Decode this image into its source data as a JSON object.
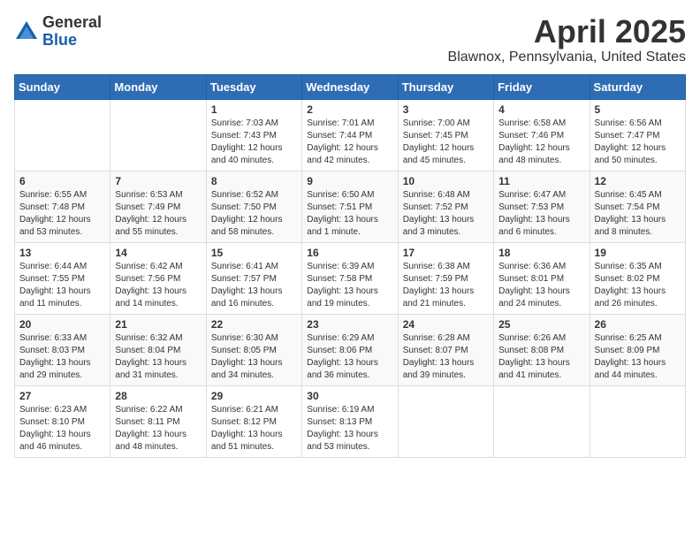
{
  "header": {
    "logo_general": "General",
    "logo_blue": "Blue",
    "month": "April 2025",
    "location": "Blawnox, Pennsylvania, United States"
  },
  "weekdays": [
    "Sunday",
    "Monday",
    "Tuesday",
    "Wednesday",
    "Thursday",
    "Friday",
    "Saturday"
  ],
  "weeks": [
    [
      null,
      null,
      {
        "day": 1,
        "sunrise": "Sunrise: 7:03 AM",
        "sunset": "Sunset: 7:43 PM",
        "daylight": "Daylight: 12 hours and 40 minutes."
      },
      {
        "day": 2,
        "sunrise": "Sunrise: 7:01 AM",
        "sunset": "Sunset: 7:44 PM",
        "daylight": "Daylight: 12 hours and 42 minutes."
      },
      {
        "day": 3,
        "sunrise": "Sunrise: 7:00 AM",
        "sunset": "Sunset: 7:45 PM",
        "daylight": "Daylight: 12 hours and 45 minutes."
      },
      {
        "day": 4,
        "sunrise": "Sunrise: 6:58 AM",
        "sunset": "Sunset: 7:46 PM",
        "daylight": "Daylight: 12 hours and 48 minutes."
      },
      {
        "day": 5,
        "sunrise": "Sunrise: 6:56 AM",
        "sunset": "Sunset: 7:47 PM",
        "daylight": "Daylight: 12 hours and 50 minutes."
      }
    ],
    [
      {
        "day": 6,
        "sunrise": "Sunrise: 6:55 AM",
        "sunset": "Sunset: 7:48 PM",
        "daylight": "Daylight: 12 hours and 53 minutes."
      },
      {
        "day": 7,
        "sunrise": "Sunrise: 6:53 AM",
        "sunset": "Sunset: 7:49 PM",
        "daylight": "Daylight: 12 hours and 55 minutes."
      },
      {
        "day": 8,
        "sunrise": "Sunrise: 6:52 AM",
        "sunset": "Sunset: 7:50 PM",
        "daylight": "Daylight: 12 hours and 58 minutes."
      },
      {
        "day": 9,
        "sunrise": "Sunrise: 6:50 AM",
        "sunset": "Sunset: 7:51 PM",
        "daylight": "Daylight: 13 hours and 1 minute."
      },
      {
        "day": 10,
        "sunrise": "Sunrise: 6:48 AM",
        "sunset": "Sunset: 7:52 PM",
        "daylight": "Daylight: 13 hours and 3 minutes."
      },
      {
        "day": 11,
        "sunrise": "Sunrise: 6:47 AM",
        "sunset": "Sunset: 7:53 PM",
        "daylight": "Daylight: 13 hours and 6 minutes."
      },
      {
        "day": 12,
        "sunrise": "Sunrise: 6:45 AM",
        "sunset": "Sunset: 7:54 PM",
        "daylight": "Daylight: 13 hours and 8 minutes."
      }
    ],
    [
      {
        "day": 13,
        "sunrise": "Sunrise: 6:44 AM",
        "sunset": "Sunset: 7:55 PM",
        "daylight": "Daylight: 13 hours and 11 minutes."
      },
      {
        "day": 14,
        "sunrise": "Sunrise: 6:42 AM",
        "sunset": "Sunset: 7:56 PM",
        "daylight": "Daylight: 13 hours and 14 minutes."
      },
      {
        "day": 15,
        "sunrise": "Sunrise: 6:41 AM",
        "sunset": "Sunset: 7:57 PM",
        "daylight": "Daylight: 13 hours and 16 minutes."
      },
      {
        "day": 16,
        "sunrise": "Sunrise: 6:39 AM",
        "sunset": "Sunset: 7:58 PM",
        "daylight": "Daylight: 13 hours and 19 minutes."
      },
      {
        "day": 17,
        "sunrise": "Sunrise: 6:38 AM",
        "sunset": "Sunset: 7:59 PM",
        "daylight": "Daylight: 13 hours and 21 minutes."
      },
      {
        "day": 18,
        "sunrise": "Sunrise: 6:36 AM",
        "sunset": "Sunset: 8:01 PM",
        "daylight": "Daylight: 13 hours and 24 minutes."
      },
      {
        "day": 19,
        "sunrise": "Sunrise: 6:35 AM",
        "sunset": "Sunset: 8:02 PM",
        "daylight": "Daylight: 13 hours and 26 minutes."
      }
    ],
    [
      {
        "day": 20,
        "sunrise": "Sunrise: 6:33 AM",
        "sunset": "Sunset: 8:03 PM",
        "daylight": "Daylight: 13 hours and 29 minutes."
      },
      {
        "day": 21,
        "sunrise": "Sunrise: 6:32 AM",
        "sunset": "Sunset: 8:04 PM",
        "daylight": "Daylight: 13 hours and 31 minutes."
      },
      {
        "day": 22,
        "sunrise": "Sunrise: 6:30 AM",
        "sunset": "Sunset: 8:05 PM",
        "daylight": "Daylight: 13 hours and 34 minutes."
      },
      {
        "day": 23,
        "sunrise": "Sunrise: 6:29 AM",
        "sunset": "Sunset: 8:06 PM",
        "daylight": "Daylight: 13 hours and 36 minutes."
      },
      {
        "day": 24,
        "sunrise": "Sunrise: 6:28 AM",
        "sunset": "Sunset: 8:07 PM",
        "daylight": "Daylight: 13 hours and 39 minutes."
      },
      {
        "day": 25,
        "sunrise": "Sunrise: 6:26 AM",
        "sunset": "Sunset: 8:08 PM",
        "daylight": "Daylight: 13 hours and 41 minutes."
      },
      {
        "day": 26,
        "sunrise": "Sunrise: 6:25 AM",
        "sunset": "Sunset: 8:09 PM",
        "daylight": "Daylight: 13 hours and 44 minutes."
      }
    ],
    [
      {
        "day": 27,
        "sunrise": "Sunrise: 6:23 AM",
        "sunset": "Sunset: 8:10 PM",
        "daylight": "Daylight: 13 hours and 46 minutes."
      },
      {
        "day": 28,
        "sunrise": "Sunrise: 6:22 AM",
        "sunset": "Sunset: 8:11 PM",
        "daylight": "Daylight: 13 hours and 48 minutes."
      },
      {
        "day": 29,
        "sunrise": "Sunrise: 6:21 AM",
        "sunset": "Sunset: 8:12 PM",
        "daylight": "Daylight: 13 hours and 51 minutes."
      },
      {
        "day": 30,
        "sunrise": "Sunrise: 6:19 AM",
        "sunset": "Sunset: 8:13 PM",
        "daylight": "Daylight: 13 hours and 53 minutes."
      },
      null,
      null,
      null
    ]
  ]
}
